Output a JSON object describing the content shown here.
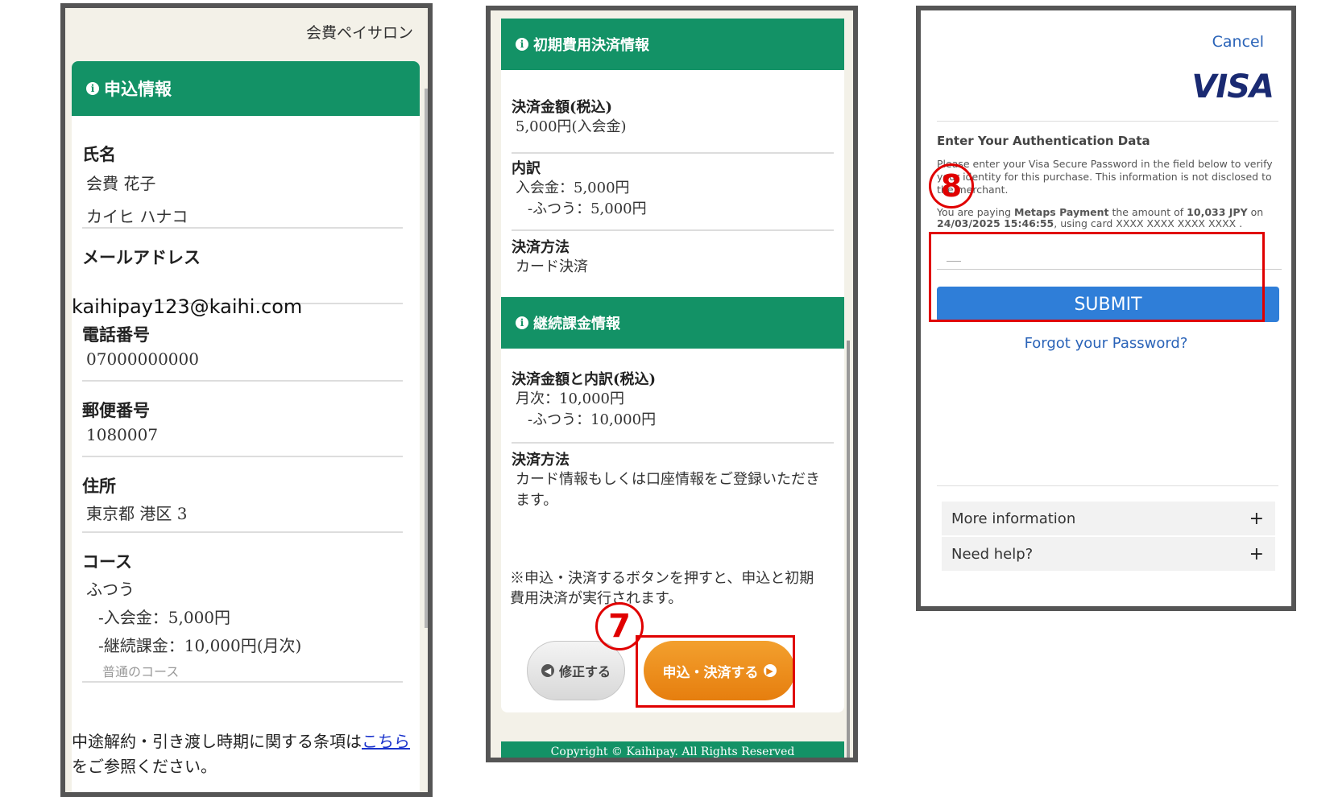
{
  "panel1": {
    "site_title": "会費ペイサロン",
    "section_title": "申込情報",
    "name_label": "氏名",
    "name_value": "会費 花子",
    "name_kana": "カイヒ ハナコ",
    "email_label": "メールアドレス",
    "email_value": "kaihipay123@kaihi.com",
    "phone_label": "電話番号",
    "phone_value": "07000000000",
    "postal_label": "郵便番号",
    "postal_value": "1080007",
    "address_label": "住所",
    "address_value": "東京都 港区 3",
    "course_label": "コース",
    "course_value": "ふつう",
    "course_fee1": "-入会金：5,000円",
    "course_fee2": "-継続課金：10,000円(月次)",
    "course_desc": "普通のコース",
    "notice_prefix": "中途解約・引き渡し時期に関する条項は",
    "notice_link": "こちら",
    "notice_suffix": "をご参照ください。"
  },
  "panel2": {
    "section1_title": "初期費用決済情報",
    "amount_label": "決済金額(税込)",
    "amount_value": "5,000円(入会金)",
    "breakdown_label": "内訳",
    "breakdown_line1": "入会金：5,000円",
    "breakdown_line2": "-ふつう：5,000円",
    "method_label": "決済方法",
    "method_value": "カード決済",
    "section2_title": "継続課金情報",
    "recurring_label": "決済金額と内訳(税込)",
    "recurring_line1": "月次：10,000円",
    "recurring_line2": "-ふつう：10,000円",
    "method2_label": "決済方法",
    "method2_value": "カード情報もしくは口座情報をご登録いただきます。",
    "note": "※申込・決済するボタンを押すと、申込と初期費用決済が実行されます。",
    "back_button": "修正する",
    "pay_button": "申込・決済する",
    "footer": "Copyright © Kaihipay. All Rights Reserved",
    "step_marker": "7"
  },
  "panel3": {
    "cancel": "Cancel",
    "brand": "VISA",
    "auth_title": "Enter Your Authentication Data",
    "description": "Please enter your Visa Secure Password in the field below to verify your identity for this purchase. This information is not disclosed to the merchant.",
    "paying_prefix": "You are paying ",
    "merchant": "Metaps Payment",
    "paying_middle": " the amount of ",
    "amount": "10,033 JPY",
    "paying_on": " on",
    "datetime": "24/03/2025 15:46:55",
    "paying_card": ", using card XXXX XXXX XXXX XXXX .",
    "submit": "SUBMIT",
    "forgot": "Forgot your Password?",
    "more_info": "More information",
    "need_help": "Need help?",
    "plus": "+",
    "step_marker": "8"
  },
  "colors": {
    "header_green": "#139266",
    "pay_orange": "#e67e0e",
    "submit_blue": "#2f7ed8",
    "highlight_red": "#e00000",
    "visa_navy": "#1a2a72"
  },
  "icons": [
    "info-circle-icon",
    "arrow-left-circle-icon",
    "arrow-right-circle-icon",
    "plus-icon"
  ]
}
